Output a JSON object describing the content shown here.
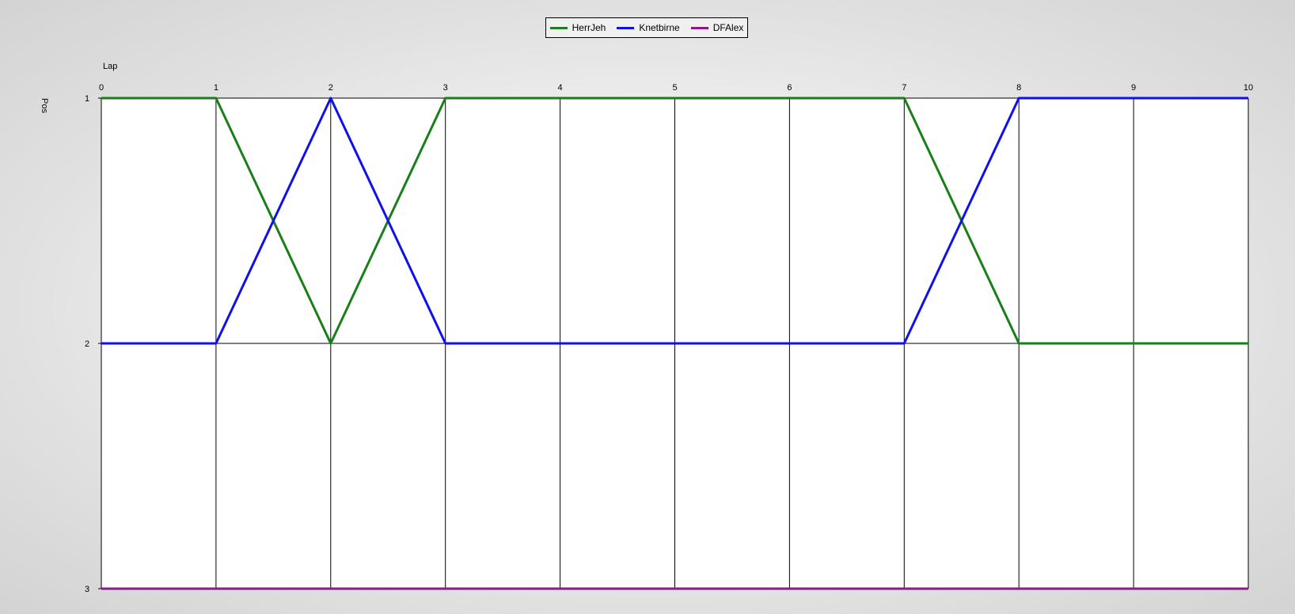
{
  "chart_data": {
    "type": "line",
    "xlabel": "Lap",
    "ylabel": "Pos",
    "x": [
      0,
      1,
      2,
      3,
      4,
      5,
      6,
      7,
      8,
      9,
      10
    ],
    "xlim": [
      0,
      10
    ],
    "ylim": [
      1,
      3
    ],
    "y_inverted": true,
    "x_ticks": [
      "0",
      "1",
      "2",
      "3",
      "4",
      "5",
      "6",
      "7",
      "8",
      "9",
      "10"
    ],
    "y_ticks": [
      "1",
      "2",
      "3"
    ],
    "grid": true,
    "legend_position": "top-center",
    "series": [
      {
        "name": "HerrJeh",
        "color": "#1a7f1a",
        "values": [
          1,
          1,
          2,
          1,
          1,
          1,
          1,
          1,
          2,
          2,
          2
        ]
      },
      {
        "name": "Knetbirne",
        "color": "#1010ee",
        "values": [
          2,
          2,
          1,
          2,
          2,
          2,
          2,
          2,
          1,
          1,
          1
        ]
      },
      {
        "name": "DFAlex",
        "color": "#8a1a8a",
        "values": [
          3,
          3,
          3,
          3,
          3,
          3,
          3,
          3,
          3,
          3,
          3
        ]
      }
    ]
  }
}
